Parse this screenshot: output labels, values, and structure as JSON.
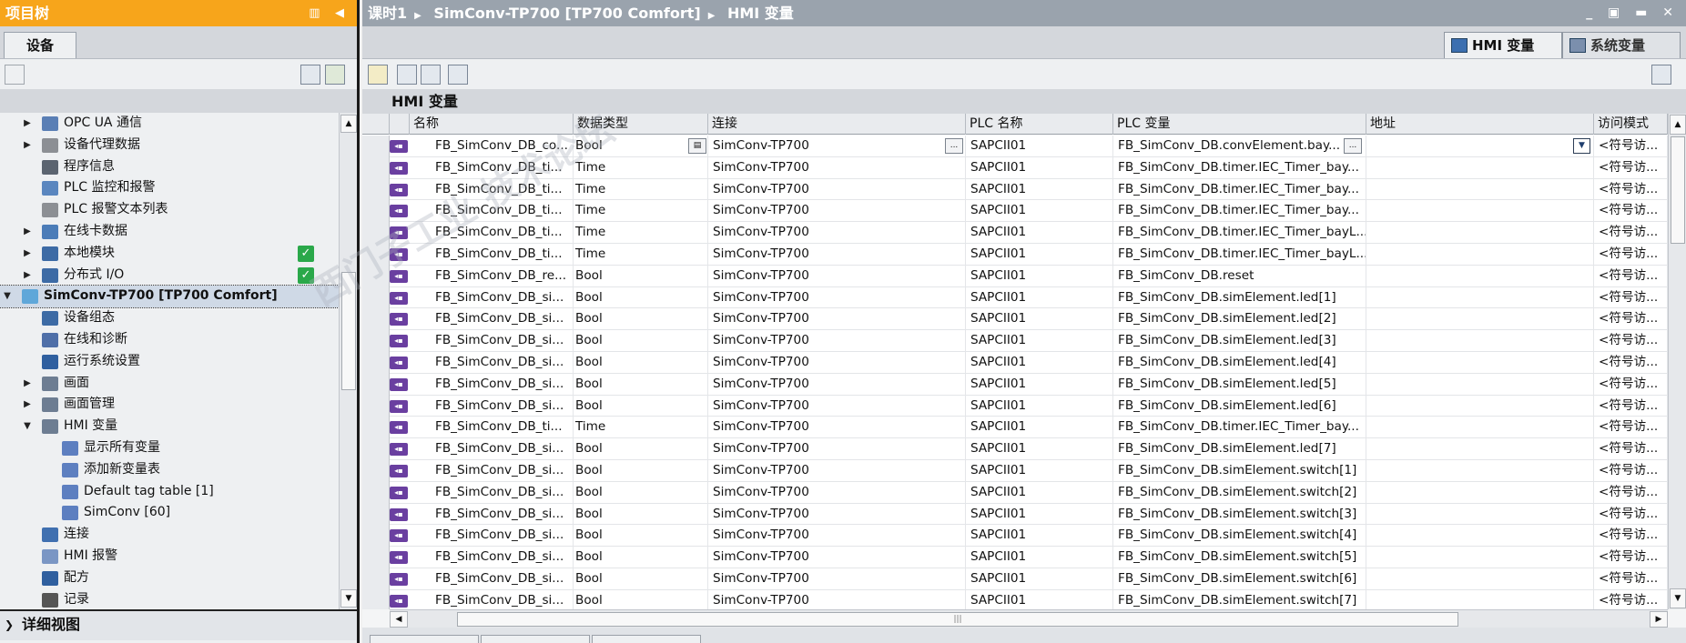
{
  "left_panel": {
    "title": "项目树",
    "title_controls": "▥ ◀",
    "tab": "设备",
    "detail_view": "详细视图"
  },
  "tree": [
    {
      "label": "OPC UA 通信",
      "level": 2,
      "arrow": "▶",
      "icon": "opcua-icon",
      "color": "#5a7fb5"
    },
    {
      "label": "设备代理数据",
      "level": 2,
      "arrow": "▶",
      "icon": "proxy-data-icon",
      "color": "#8c8f94"
    },
    {
      "label": "程序信息",
      "level": 2,
      "arrow": "",
      "icon": "program-info-icon",
      "color": "#5b6470"
    },
    {
      "label": "PLC 监控和报警",
      "level": 2,
      "arrow": "",
      "icon": "plc-alarm-icon",
      "color": "#5a86bf"
    },
    {
      "label": "PLC 报警文本列表",
      "level": 2,
      "arrow": "",
      "icon": "alarm-text-icon",
      "color": "#8c8f94"
    },
    {
      "label": "在线卡数据",
      "level": 2,
      "arrow": "▶",
      "icon": "online-card-icon",
      "color": "#4b7cb8"
    },
    {
      "label": "本地模块",
      "level": 2,
      "arrow": "▶",
      "icon": "local-module-icon",
      "color": "#3d6ba5",
      "check": true
    },
    {
      "label": "分布式 I/O",
      "level": 2,
      "arrow": "▶",
      "icon": "distributed-io-icon",
      "color": "#3d6ba5",
      "check": true
    },
    {
      "label": "SimConv-TP700 [TP700 Comfort]",
      "level": 1,
      "arrow": "▼",
      "icon": "hmi-device-icon",
      "color": "#5fa7d9",
      "bold": true,
      "selected": true
    },
    {
      "label": "设备组态",
      "level": 2,
      "arrow": "",
      "icon": "device-config-icon",
      "color": "#3d6ba5"
    },
    {
      "label": "在线和诊断",
      "level": 2,
      "arrow": "",
      "icon": "online-diag-icon",
      "color": "#4f6fa8"
    },
    {
      "label": "运行系统设置",
      "level": 2,
      "arrow": "",
      "icon": "runtime-settings-icon",
      "color": "#2f5f9f"
    },
    {
      "label": "画面",
      "level": 2,
      "arrow": "▶",
      "icon": "screens-folder-icon",
      "color": "#6d7d92"
    },
    {
      "label": "画面管理",
      "level": 2,
      "arrow": "▶",
      "icon": "screen-mgmt-folder-icon",
      "color": "#6d7d92"
    },
    {
      "label": "HMI 变量",
      "level": 2,
      "arrow": "▼",
      "icon": "hmi-tags-folder-icon",
      "color": "#6d7d92"
    },
    {
      "label": "显示所有变量",
      "level": 3,
      "arrow": "",
      "icon": "show-all-tags-icon",
      "color": "#5d7fc0"
    },
    {
      "label": "添加新变量表",
      "level": 3,
      "arrow": "",
      "icon": "add-tag-table-icon",
      "color": "#5d7fc0"
    },
    {
      "label": "Default tag table [1]",
      "level": 3,
      "arrow": "",
      "icon": "tag-table-icon",
      "color": "#5d7fc0"
    },
    {
      "label": "SimConv [60]",
      "level": 3,
      "arrow": "",
      "icon": "tag-table-icon",
      "color": "#5d7fc0"
    },
    {
      "label": "连接",
      "level": 2,
      "arrow": "",
      "icon": "connections-icon",
      "color": "#4070b0"
    },
    {
      "label": "HMI 报警",
      "level": 2,
      "arrow": "",
      "icon": "hmi-alarms-icon",
      "color": "#7a96c4"
    },
    {
      "label": "配方",
      "level": 2,
      "arrow": "",
      "icon": "recipes-icon",
      "color": "#2f5f9f"
    },
    {
      "label": "记录",
      "level": 2,
      "arrow": "",
      "icon": "logs-icon",
      "color": "#555"
    }
  ],
  "breadcrumb": [
    "课时1",
    "SimConv-TP700 [TP700 Comfort]",
    "HMI 变量"
  ],
  "window_controls": "_ ▣ ▬ ✕",
  "view_tabs": {
    "hmi": "HMI 变量",
    "system": "系统变量"
  },
  "table_title": "HMI 变量",
  "columns": [
    "名称",
    "数据类型",
    "连接",
    "PLC 名称",
    "PLC 变量",
    "地址",
    "访问模式"
  ],
  "rows": [
    [
      "FB_SimConv_DB_co...",
      "Bool",
      "SimConv-TP700",
      "SAPCII01",
      "FB_SimConv_DB.convElement.bay...",
      "",
      "<符号访..."
    ],
    [
      "FB_SimConv_DB_ti...",
      "Time",
      "SimConv-TP700",
      "SAPCII01",
      "FB_SimConv_DB.timer.IEC_Timer_bay...",
      "",
      "<符号访..."
    ],
    [
      "FB_SimConv_DB_ti...",
      "Time",
      "SimConv-TP700",
      "SAPCII01",
      "FB_SimConv_DB.timer.IEC_Timer_bay...",
      "",
      "<符号访..."
    ],
    [
      "FB_SimConv_DB_ti...",
      "Time",
      "SimConv-TP700",
      "SAPCII01",
      "FB_SimConv_DB.timer.IEC_Timer_bay...",
      "",
      "<符号访..."
    ],
    [
      "FB_SimConv_DB_ti...",
      "Time",
      "SimConv-TP700",
      "SAPCII01",
      "FB_SimConv_DB.timer.IEC_Timer_bayL...",
      "",
      "<符号访..."
    ],
    [
      "FB_SimConv_DB_ti...",
      "Time",
      "SimConv-TP700",
      "SAPCII01",
      "FB_SimConv_DB.timer.IEC_Timer_bayL...",
      "",
      "<符号访..."
    ],
    [
      "FB_SimConv_DB_re...",
      "Bool",
      "SimConv-TP700",
      "SAPCII01",
      "FB_SimConv_DB.reset",
      "",
      "<符号访..."
    ],
    [
      "FB_SimConv_DB_si...",
      "Bool",
      "SimConv-TP700",
      "SAPCII01",
      "FB_SimConv_DB.simElement.led[1]",
      "",
      "<符号访..."
    ],
    [
      "FB_SimConv_DB_si...",
      "Bool",
      "SimConv-TP700",
      "SAPCII01",
      "FB_SimConv_DB.simElement.led[2]",
      "",
      "<符号访..."
    ],
    [
      "FB_SimConv_DB_si...",
      "Bool",
      "SimConv-TP700",
      "SAPCII01",
      "FB_SimConv_DB.simElement.led[3]",
      "",
      "<符号访..."
    ],
    [
      "FB_SimConv_DB_si...",
      "Bool",
      "SimConv-TP700",
      "SAPCII01",
      "FB_SimConv_DB.simElement.led[4]",
      "",
      "<符号访..."
    ],
    [
      "FB_SimConv_DB_si...",
      "Bool",
      "SimConv-TP700",
      "SAPCII01",
      "FB_SimConv_DB.simElement.led[5]",
      "",
      "<符号访..."
    ],
    [
      "FB_SimConv_DB_si...",
      "Bool",
      "SimConv-TP700",
      "SAPCII01",
      "FB_SimConv_DB.simElement.led[6]",
      "",
      "<符号访..."
    ],
    [
      "FB_SimConv_DB_ti...",
      "Time",
      "SimConv-TP700",
      "SAPCII01",
      "FB_SimConv_DB.timer.IEC_Timer_bay...",
      "",
      "<符号访..."
    ],
    [
      "FB_SimConv_DB_si...",
      "Bool",
      "SimConv-TP700",
      "SAPCII01",
      "FB_SimConv_DB.simElement.led[7]",
      "",
      "<符号访..."
    ],
    [
      "FB_SimConv_DB_si...",
      "Bool",
      "SimConv-TP700",
      "SAPCII01",
      "FB_SimConv_DB.simElement.switch[1]",
      "",
      "<符号访..."
    ],
    [
      "FB_SimConv_DB_si...",
      "Bool",
      "SimConv-TP700",
      "SAPCII01",
      "FB_SimConv_DB.simElement.switch[2]",
      "",
      "<符号访..."
    ],
    [
      "FB_SimConv_DB_si...",
      "Bool",
      "SimConv-TP700",
      "SAPCII01",
      "FB_SimConv_DB.simElement.switch[3]",
      "",
      "<符号访..."
    ],
    [
      "FB_SimConv_DB_si...",
      "Bool",
      "SimConv-TP700",
      "SAPCII01",
      "FB_SimConv_DB.simElement.switch[4]",
      "",
      "<符号访..."
    ],
    [
      "FB_SimConv_DB_si...",
      "Bool",
      "SimConv-TP700",
      "SAPCII01",
      "FB_SimConv_DB.simElement.switch[5]",
      "",
      "<符号访..."
    ],
    [
      "FB_SimConv_DB_si...",
      "Bool",
      "SimConv-TP700",
      "SAPCII01",
      "FB_SimConv_DB.simElement.switch[6]",
      "",
      "<符号访..."
    ],
    [
      "FB_SimConv_DB_si...",
      "Bool",
      "SimConv-TP700",
      "SAPCII01",
      "FB_SimConv_DB.simElement.switch[7]",
      "",
      "<符号访..."
    ]
  ],
  "accent_color": "#f7a51b",
  "watermark": "西门子工业 技术论坛"
}
